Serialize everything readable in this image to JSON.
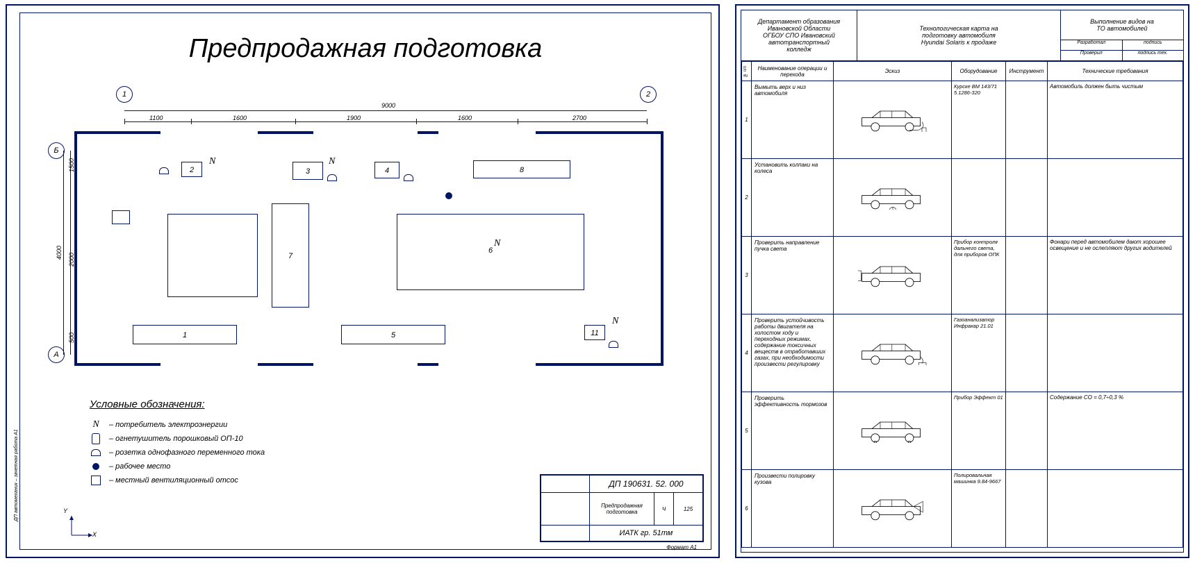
{
  "left": {
    "title": "Предпродажная подготовка",
    "grid_letters": {
      "a": "А",
      "b": "Б"
    },
    "grid_numbers": {
      "n1": "1",
      "n2": "2"
    },
    "dimensions": {
      "total_width": "9000",
      "seg1": "1100",
      "seg2": "1600",
      "seg3": "1900",
      "seg4": "1600",
      "seg5": "2700",
      "total_height": "4000",
      "h1": "1500",
      "h2": "2000",
      "h3": "500"
    },
    "blocks": {
      "b1": "1",
      "b2": "2",
      "b3": "3",
      "b4": "4",
      "b5": "5",
      "b6": "6",
      "b7": "7",
      "b8": "8",
      "b11": "11"
    },
    "legend": {
      "title": "Условные обозначения:",
      "items": [
        {
          "sym": "N",
          "label": "– потребитель электроэнергии"
        },
        {
          "sym": "ext",
          "label": "– огнетушитель порошковый ОП-10"
        },
        {
          "sym": "sock",
          "label": "– розетка однофазного переменного тока"
        },
        {
          "sym": "dot",
          "label": "– рабочее место"
        },
        {
          "sym": "sq",
          "label": "– местный вентиляционный отсос"
        }
      ]
    },
    "axis": {
      "x": "X",
      "y": "Y"
    },
    "stamp": {
      "code": "ДП 190631. 52. 000",
      "name_l1": "Предпродажная",
      "name_l2": "подготовка",
      "school": "ИАТК гр. 51тм",
      "lit": "Ч",
      "mass": "125",
      "format": "Формат   А1",
      "side": "ДП автомеханик – зачетная работа А1"
    }
  },
  "right": {
    "head": {
      "c1_l1": "Департамент образования",
      "c1_l2": "Ивановской Области",
      "c1_l3": "ОГБОУ СПО Ивановский",
      "c1_l4": "автотранспортный",
      "c1_l5": "колледж",
      "c2_l1": "Технологическая карта на",
      "c2_l2": "подготовку автомобиля",
      "c2_l3": "Hyundai Solaris к продаже",
      "c3_l1": "Выполнение видов на",
      "c3_l2": "ТО автомобилей",
      "c3_small1_l": "Разработал",
      "c3_small1_r": "подпись",
      "c3_small2_l": "Проверил",
      "c3_small2_r": "подпись тех."
    },
    "cols": {
      "n": "№ п/п",
      "op": "Наименование операции и перехода",
      "sketch": "Эскиз",
      "equip": "Оборудование",
      "tool": "Инструмент",
      "req": "Технические требования"
    },
    "rows": [
      {
        "n": "1",
        "op": "Вымыть верх и низ автомобиля",
        "equip": "Курске ВМ 143/71 5.1286-320",
        "tool": "",
        "req": "Автомобиль должен быть чистым"
      },
      {
        "n": "2",
        "op": "Установить колпаки на колеса",
        "equip": "",
        "tool": "",
        "req": ""
      },
      {
        "n": "3",
        "op": "Проверить направление пучка света",
        "equip": "Прибор контроля дальнего света, для приборов ОПК",
        "tool": "",
        "req": "Фонари перед автомобилем дают хорошее освещение и не ослепляют других водителей"
      },
      {
        "n": "4",
        "op": "Проверить устойчивость работы двигателя на холостом ходу и переходных режимах, содержание токсичных веществ в отработавших газах, при необходимости произвести регулировку",
        "equip": "Газоанализатор Инфракар 21.01",
        "tool": "",
        "req": ""
      },
      {
        "n": "5",
        "op": "Проверить эффективность тормозов",
        "equip": "Прибор Эффект 01",
        "tool": "",
        "req": "Содержание СО = 0,7÷0,3 %"
      },
      {
        "n": "6",
        "op": "Произвести полировку кузова",
        "equip": "Полировальная машинка 9.84-9667",
        "tool": "",
        "req": ""
      }
    ]
  }
}
